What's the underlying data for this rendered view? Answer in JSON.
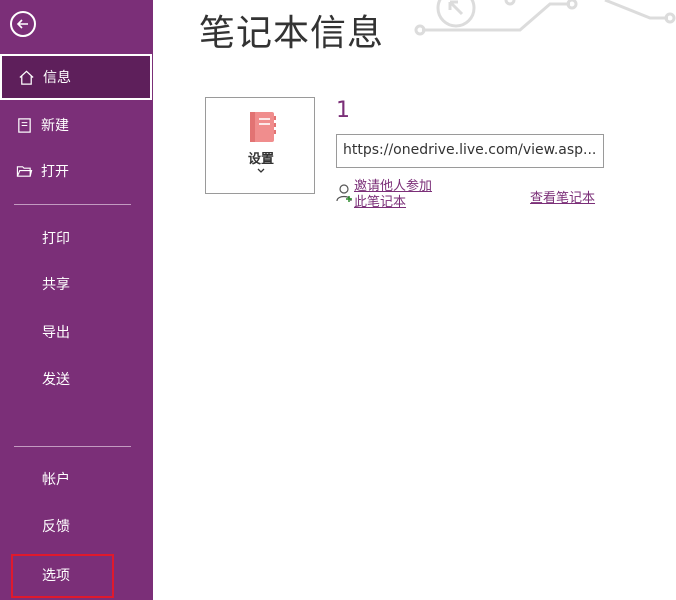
{
  "sidebar": {
    "items": [
      {
        "label": "信息",
        "icon": "home-icon"
      },
      {
        "label": "新建",
        "icon": "new-page-icon"
      },
      {
        "label": "打开",
        "icon": "folder-open-icon"
      },
      {
        "label": "打印"
      },
      {
        "label": "共享"
      },
      {
        "label": "导出"
      },
      {
        "label": "发送"
      },
      {
        "label": "帐户"
      },
      {
        "label": "反馈"
      },
      {
        "label": "选项"
      }
    ],
    "active_index": 0,
    "highlighted_index": 9
  },
  "main": {
    "title": "笔记本信息",
    "settings_label": "设置",
    "notebook_name": "1",
    "url": "https://onedrive.live.com/view.asp...",
    "invite_label": "邀请他人参加此笔记本",
    "view_notebook_label": "查看笔记本"
  },
  "colors": {
    "sidebar_bg": "#7b2f78",
    "active_bg": "#5e1f5b",
    "accent": "#7b2f78",
    "highlight_border": "#e0192d"
  }
}
